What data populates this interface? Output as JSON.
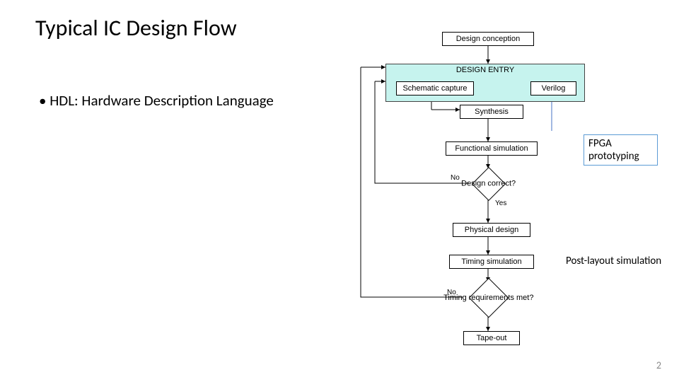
{
  "title": "Typical IC Design Flow",
  "bullet": "HDL: Hardware Description Language",
  "slidenum": "2",
  "nodes": {
    "conception": "Design conception",
    "entry_header": "DESIGN ENTRY",
    "schematic": "Schematic capture",
    "verilog": "Verilog",
    "synthesis": "Synthesis",
    "funcsim": "Functional simulation",
    "correct": "Design correct?",
    "physical": "Physical design",
    "timingsim": "Timing simulation",
    "timingmet": "Timing requirements met?",
    "tapeout": "Tape-out"
  },
  "labels": {
    "no1": "No",
    "yes1": "Yes",
    "no2": "No"
  },
  "annotations": {
    "fpga1": "FPGA",
    "fpga2": "prototyping",
    "postlayout": "Post-layout simulation"
  }
}
